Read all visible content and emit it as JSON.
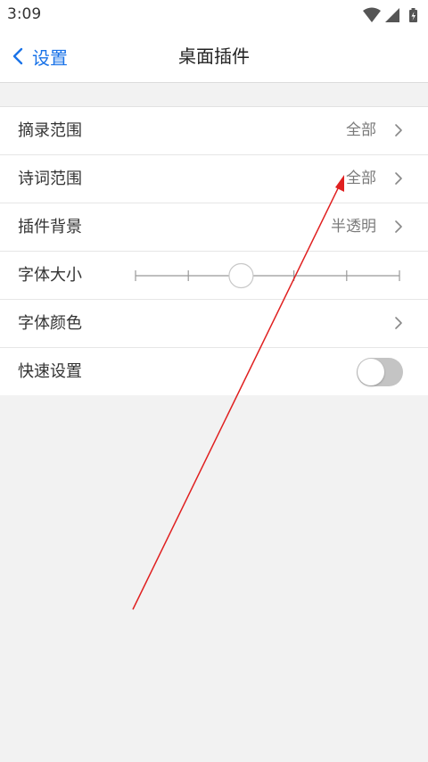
{
  "status_bar": {
    "time": "3:09",
    "icons": [
      "wifi-icon",
      "cell-signal-icon",
      "battery-charging-icon"
    ]
  },
  "nav": {
    "back_label": "设置",
    "title": "桌面插件"
  },
  "settings": [
    {
      "label": "摘录范围",
      "value": "全部",
      "has_chevron": true
    },
    {
      "label": "诗词范围",
      "value": "全部",
      "has_chevron": true
    },
    {
      "label": "插件背景",
      "value": "半透明",
      "has_chevron": true
    },
    {
      "label": "字体大小",
      "control": "slider",
      "slider_ticks": 6,
      "slider_value_index": 2
    },
    {
      "label": "字体颜色",
      "value": "",
      "has_chevron": true
    },
    {
      "label": "快速设置",
      "control": "toggle",
      "toggle_on": false
    }
  ],
  "colors": {
    "accent": "#1a73e8",
    "annotation_arrow": "#e02020",
    "background": "#f2f2f2"
  }
}
